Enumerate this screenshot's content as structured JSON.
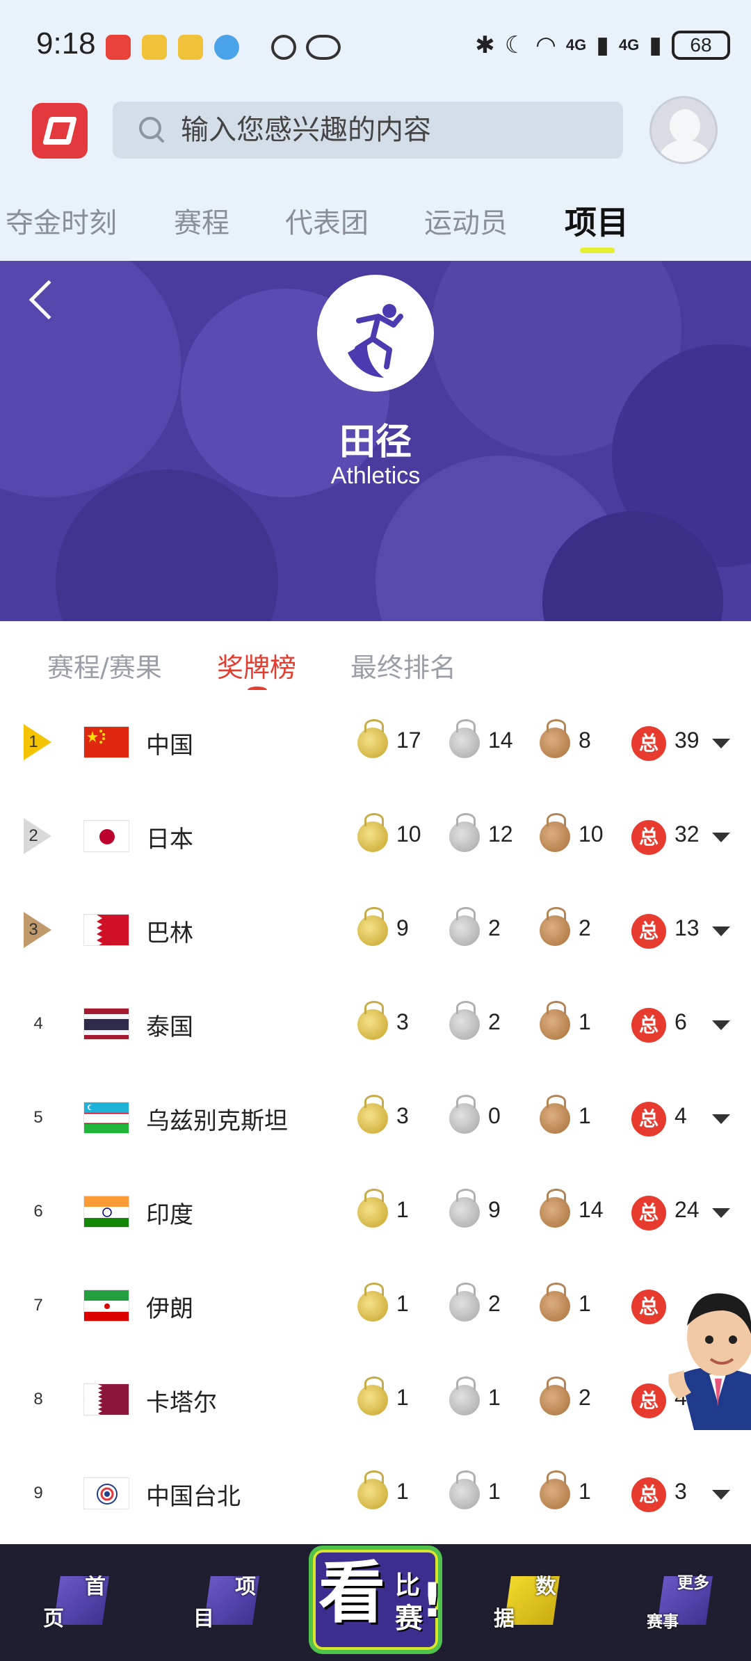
{
  "status_bar": {
    "time": "9:18",
    "notification_icons": [
      "huawei-store-icon",
      "weibo-icon",
      "weibo-icon",
      "browser-icon"
    ],
    "extra_icons": [
      "data-saver-icon",
      "eye-icon"
    ],
    "right_icons": [
      "bluetooth-icon",
      "moon-icon",
      "wifi-icon",
      "signal-4g-icon",
      "signal-4g-icon"
    ],
    "signal_label_1": "4G",
    "signal_label_2": "4G",
    "battery": "68"
  },
  "header": {
    "search_placeholder": "输入您感兴趣的内容"
  },
  "nav_tabs": [
    {
      "label": "夺金时刻",
      "active": false
    },
    {
      "label": "赛程",
      "active": false
    },
    {
      "label": "代表团",
      "active": false
    },
    {
      "label": "运动员",
      "active": false
    },
    {
      "label": "项目",
      "active": true
    }
  ],
  "banner": {
    "title": "田径",
    "subtitle": "Athletics",
    "icon": "running-athlete-icon"
  },
  "sub_tabs": [
    {
      "label": "赛程/赛果",
      "active": false
    },
    {
      "label": "奖牌榜",
      "active": true
    },
    {
      "label": "最终排名",
      "active": false
    }
  ],
  "total_badge": "总",
  "medal_table": [
    {
      "rank": "1",
      "country": "中国",
      "flag": "china",
      "gold": "17",
      "silver": "14",
      "bronze": "8",
      "total": "39"
    },
    {
      "rank": "2",
      "country": "日本",
      "flag": "japan",
      "gold": "10",
      "silver": "12",
      "bronze": "10",
      "total": "32"
    },
    {
      "rank": "3",
      "country": "巴林",
      "flag": "bahrain",
      "gold": "9",
      "silver": "2",
      "bronze": "2",
      "total": "13"
    },
    {
      "rank": "4",
      "country": "泰国",
      "flag": "thailand",
      "gold": "3",
      "silver": "2",
      "bronze": "1",
      "total": "6"
    },
    {
      "rank": "5",
      "country": "乌兹别克斯坦",
      "flag": "uzbekistan",
      "gold": "3",
      "silver": "0",
      "bronze": "1",
      "total": "4"
    },
    {
      "rank": "6",
      "country": "印度",
      "flag": "india",
      "gold": "1",
      "silver": "9",
      "bronze": "14",
      "total": "24"
    },
    {
      "rank": "7",
      "country": "伊朗",
      "flag": "iran",
      "gold": "1",
      "silver": "2",
      "bronze": "1",
      "total": ""
    },
    {
      "rank": "8",
      "country": "卡塔尔",
      "flag": "qatar",
      "gold": "1",
      "silver": "1",
      "bronze": "2",
      "total": "4"
    },
    {
      "rank": "9",
      "country": "中国台北",
      "flag": "chinese-taipei",
      "gold": "1",
      "silver": "1",
      "bronze": "1",
      "total": "3"
    }
  ],
  "bottom_nav": [
    {
      "top": "首",
      "bottom": "页"
    },
    {
      "top": "项",
      "bottom": "目"
    },
    {
      "center_big": "看",
      "center_top": "比",
      "center_bottom": "赛",
      "center_mark": "!"
    },
    {
      "top": "数",
      "bottom": "据"
    },
    {
      "top": "更多",
      "bottom": "赛事"
    }
  ],
  "colors": {
    "accent_red": "#e43d30",
    "banner_purple": "#4a3c9e",
    "tab_indicator": "#e7ef32",
    "rank_gold": "#f5c400",
    "rank_silver": "#d9d9d9",
    "rank_bronze": "#c19a6b"
  }
}
